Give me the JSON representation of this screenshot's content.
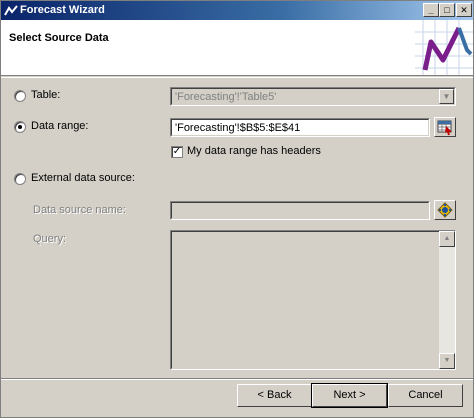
{
  "window": {
    "title": "Forecast Wizard"
  },
  "title_buttons": {
    "minimize": "_",
    "maximize": "□",
    "close": "✕"
  },
  "header": {
    "heading": "Select Source Data"
  },
  "options": {
    "table": {
      "label": "Table:",
      "selected": false,
      "value": "'Forecasting'!'Table5'"
    },
    "data_range": {
      "label": "Data range:",
      "selected": true,
      "value": "'Forecasting'!$B$5:$E$41"
    },
    "headers_checkbox": {
      "label": "My data range has headers",
      "checked": true,
      "mark": "✓"
    },
    "external": {
      "label": "External data source:",
      "selected": false
    },
    "data_source_name": {
      "label": "Data source name:",
      "value": ""
    },
    "query": {
      "label": "Query:",
      "value": ""
    }
  },
  "buttons": {
    "back": "< Back",
    "next": "Next >",
    "cancel": "Cancel"
  },
  "colors": {
    "titlebar_start": "#0a246a",
    "titlebar_end": "#a6caf0",
    "dialog_bg": "#d4d0c8",
    "header_bg": "#ffffff"
  }
}
